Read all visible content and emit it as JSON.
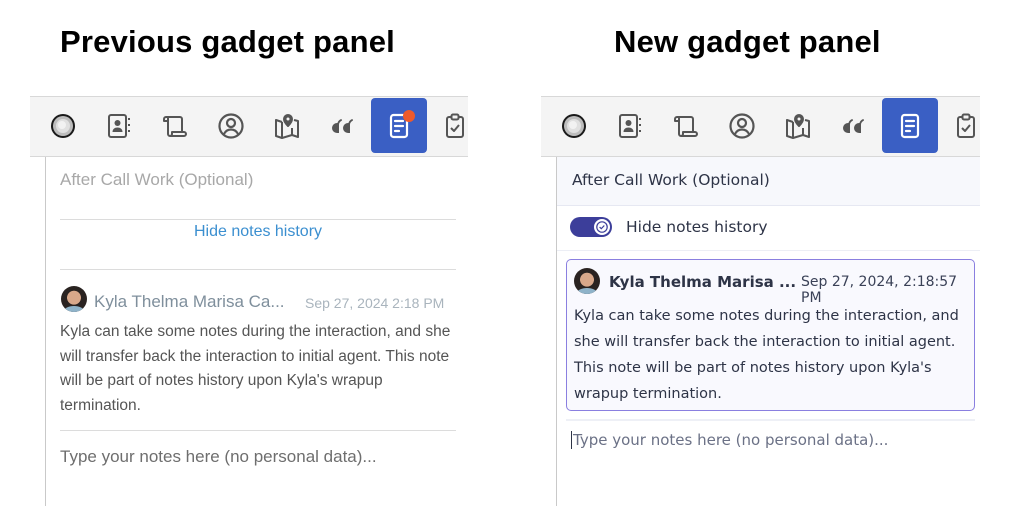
{
  "headings": {
    "previous": "Previous gadget panel",
    "new": "New gadget panel"
  },
  "toolbar": {
    "icons": [
      {
        "name": "status-circle-icon"
      },
      {
        "name": "contact-book-icon"
      },
      {
        "name": "script-scroll-icon"
      },
      {
        "name": "user-profile-icon"
      },
      {
        "name": "map-icon"
      },
      {
        "name": "quote-icon"
      },
      {
        "name": "notes-icon",
        "active": true
      },
      {
        "name": "clipboard-check-icon"
      }
    ],
    "active_color": "#3a5fc4",
    "badge_color": "#ee5a2c"
  },
  "previous_panel": {
    "section_title": "After Call Work (Optional)",
    "hide_history_link": "Hide notes history",
    "note": {
      "author": "Kyla Thelma Marisa Ca...",
      "timestamp": "Sep 27, 2024 2:18 PM",
      "text": "Kyla can take some notes during the interaction, and she will transfer back the interaction to initial agent. This note will be part of notes history upon Kyla's wrapup termination."
    },
    "input_placeholder": "Type your notes here (no personal data)..."
  },
  "new_panel": {
    "section_title": "After Call Work (Optional)",
    "toggle_label": "Hide notes history",
    "toggle_on": true,
    "note": {
      "author": "Kyla Thelma Marisa ...",
      "timestamp": "Sep 27, 2024, 2:18:57 PM",
      "text": "Kyla can take some notes during the interaction, and she will transfer back the interaction to initial agent. This note will be part of notes history upon Kyla's wrapup termination."
    },
    "input_placeholder": "Type your notes here (no personal data)..."
  }
}
